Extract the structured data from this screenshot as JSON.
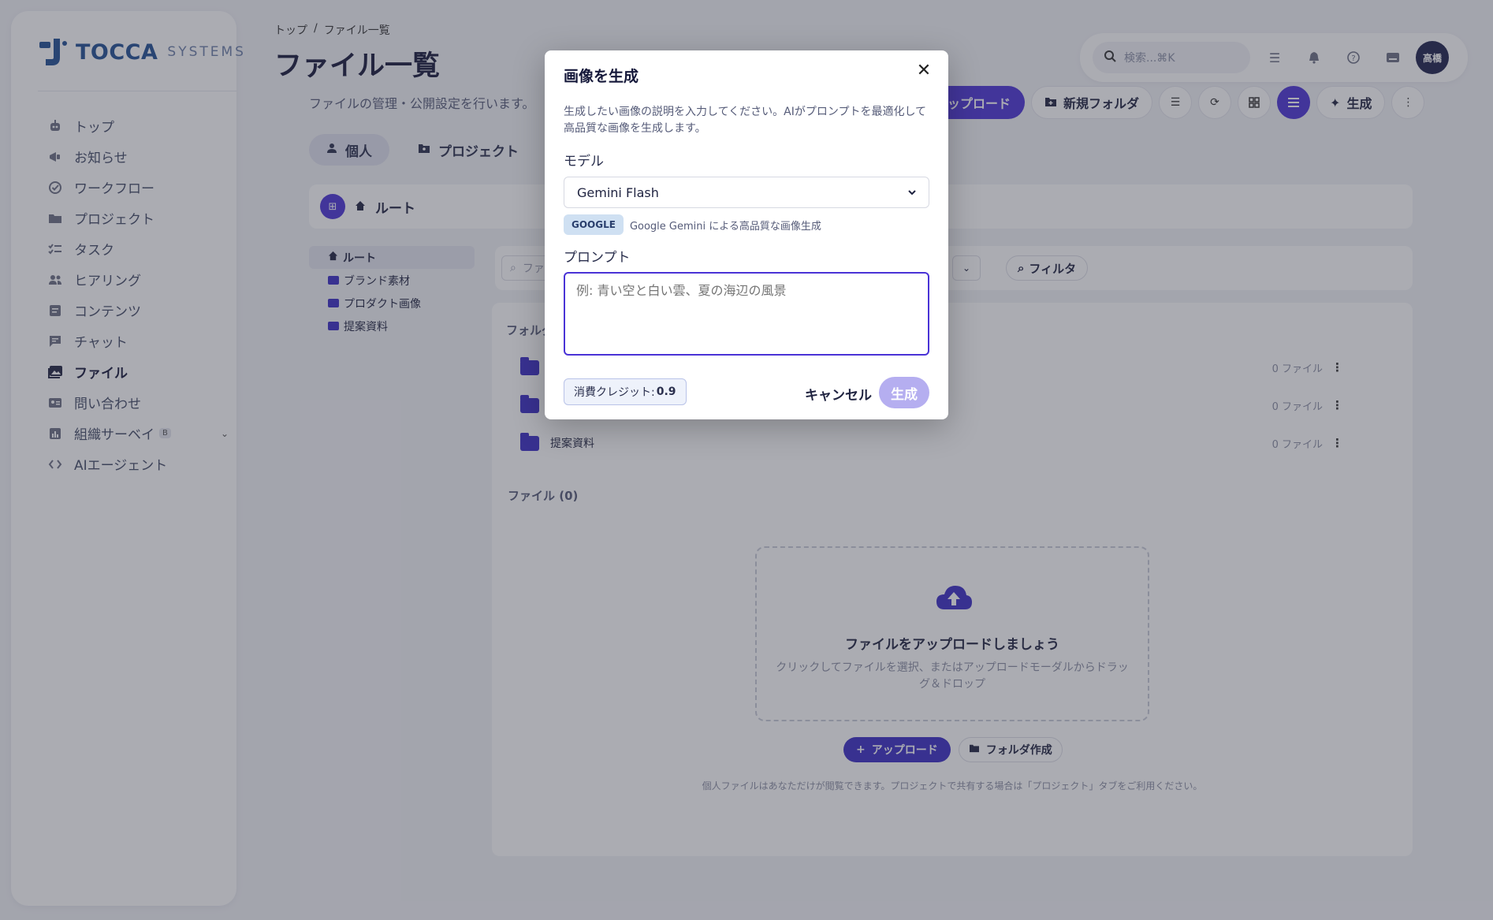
{
  "brand": {
    "name": "TOCCA",
    "sub": "SYSTEMS"
  },
  "sidebar": {
    "items": [
      {
        "label": "トップ",
        "icon": "robot-icon"
      },
      {
        "label": "お知らせ",
        "icon": "megaphone-icon"
      },
      {
        "label": "ワークフロー",
        "icon": "check-circle-icon"
      },
      {
        "label": "プロジェクト",
        "icon": "folder-icon"
      },
      {
        "label": "タスク",
        "icon": "checklist-icon"
      },
      {
        "label": "ヒアリング",
        "icon": "people-icon"
      },
      {
        "label": "コンテンツ",
        "icon": "document-icon"
      },
      {
        "label": "チャット",
        "icon": "chat-icon"
      },
      {
        "label": "ファイル",
        "icon": "images-icon",
        "active": true
      },
      {
        "label": "問い合わせ",
        "icon": "contact-card-icon"
      },
      {
        "label": "組織サーベイ",
        "icon": "bar-chart-icon",
        "badge": "B"
      },
      {
        "label": "AIエージェント",
        "icon": "code-icon"
      }
    ]
  },
  "header": {
    "breadcrumb": [
      "トップ",
      "/",
      "ファイル一覧"
    ],
    "title": "ファイル一覧",
    "subtitle": "ファイルの管理・公開設定を行います。",
    "search_placeholder": "検索...⌘K",
    "avatar": "高橋"
  },
  "toolbar": {
    "upload_label": "ップロード",
    "new_folder_label": "新規フォルダ",
    "generate_label": "生成"
  },
  "tabs": {
    "personal": "個人",
    "project": "プロジェクト"
  },
  "root": {
    "label": "ルート"
  },
  "tree": {
    "items": [
      {
        "label": "ルート",
        "active": true
      },
      {
        "label": "ブランド素材"
      },
      {
        "label": "プロダクト画像"
      },
      {
        "label": "提案資料"
      }
    ]
  },
  "filter": {
    "search_placeholder": "ファ",
    "filter_label": "フィルタ"
  },
  "content": {
    "folders_label": "フォルダ",
    "folders": [
      {
        "name": "",
        "count": "0 ファイル"
      },
      {
        "name": "",
        "count": "0 ファイル"
      },
      {
        "name": "提案資料",
        "count": "0 ファイル"
      }
    ],
    "files_label": "ファイル (0)",
    "empty_title": "ファイルをアップロードしましょう",
    "empty_desc": "クリックしてファイルを選択、またはアップロードモーダルからドラッグ＆ドロップ",
    "upload_label": "アップロード",
    "create_folder_label": "フォルダ作成",
    "note": "個人ファイルはあなただけが閲覧できます。プロジェクトで共有する場合は「プロジェクト」タブをご利用ください。"
  },
  "modal": {
    "title": "画像を生成",
    "description": "生成したい画像の説明を入力してください。AIがプロンプトを最適化して高品質な画像を生成します。",
    "model_label": "モデル",
    "model_value": "Gemini Flash",
    "provider_badge": "GOOGLE",
    "provider_desc": "Google Gemini による高品質な画像生成",
    "prompt_label": "プロンプト",
    "prompt_placeholder": "例: 青い空と白い雲、夏の海辺の風景",
    "credit_label": "消費クレジット:",
    "credit_value": "0.9",
    "cancel_label": "キャンセル",
    "generate_label": "生成"
  },
  "colors": {
    "accent": "#4a33d6",
    "folder": "#3a2bc4",
    "brand": "#1f4f93"
  }
}
